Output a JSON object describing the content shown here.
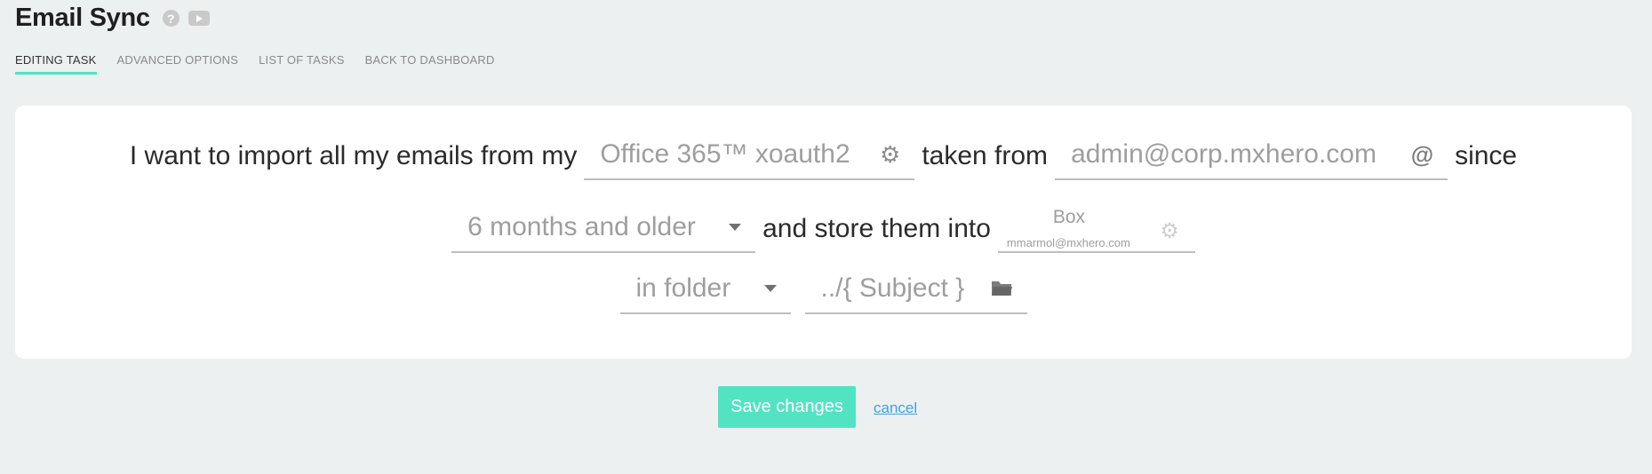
{
  "header": {
    "title": "Email Sync",
    "help_icon_glyph": "?"
  },
  "tabs": [
    {
      "label": "EDITING TASK"
    },
    {
      "label": "ADVANCED OPTIONS"
    },
    {
      "label": "LIST OF TASKS"
    },
    {
      "label": "BACK TO DASHBOARD"
    }
  ],
  "form": {
    "text_import": "I want to import all my emails from my",
    "source_service": "Office 365™ xoauth2",
    "text_taken_from": "taken from",
    "source_email": "admin@corp.mxhero.com",
    "at_symbol": "@",
    "text_since": "since",
    "age_filter": "6 months and older",
    "text_store": "and store them into",
    "destination": {
      "service": "Box",
      "account": "mmarmol@mxhero.com"
    },
    "folder_mode": "in folder",
    "folder_path": "../{ Subject }"
  },
  "actions": {
    "save_label": "Save changes",
    "cancel_label": "cancel"
  },
  "colors": {
    "accent": "#52e3c2",
    "tab_underline": "#4fe3c1",
    "link": "#3aa4e0",
    "background": "#edf0f1"
  },
  "icons": {
    "service_settings": "gear-icon",
    "email_at": "at-icon",
    "age_dropdown": "chevron-down-icon",
    "destination_settings": "gear-icon",
    "folder_dropdown": "chevron-down-icon",
    "folder_picker": "folder-icon"
  }
}
